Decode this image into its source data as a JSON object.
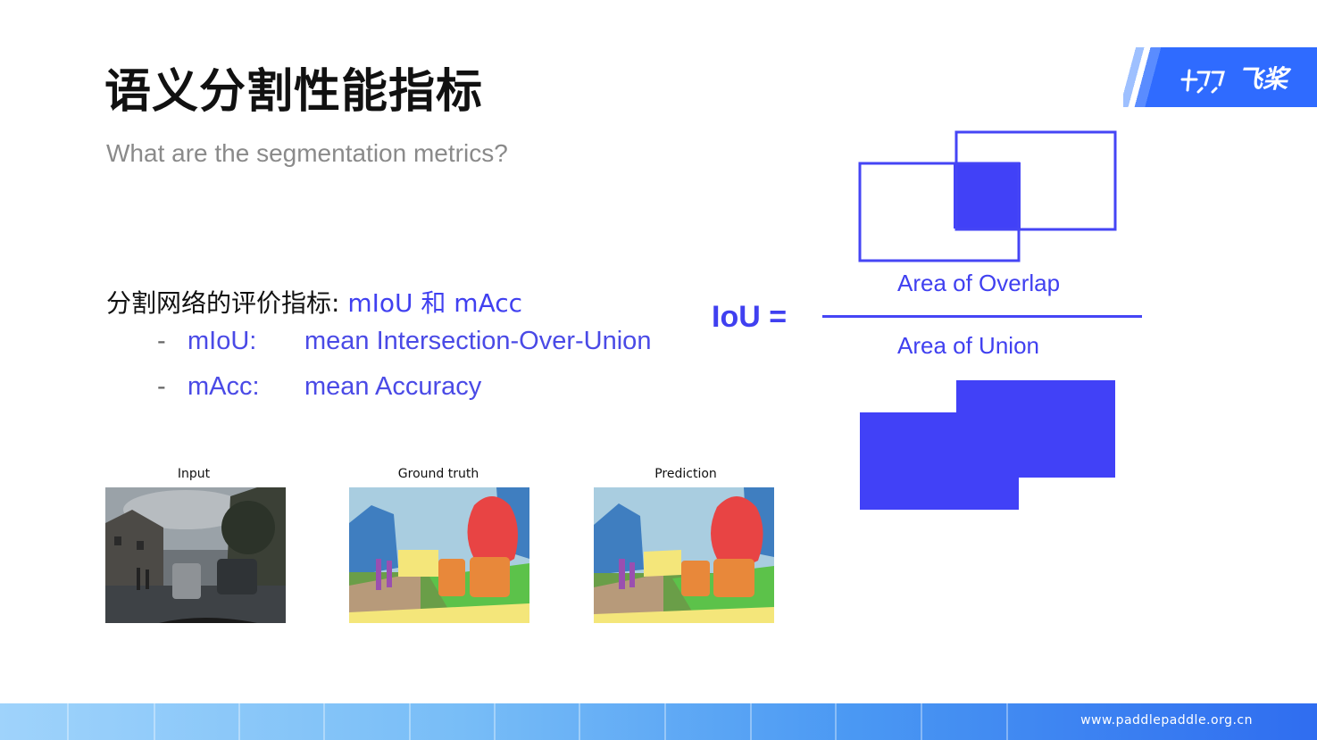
{
  "slide": {
    "title": "语义分割性能指标",
    "subtitle": "What are the segmentation metrics?"
  },
  "logo": {
    "text": "飞桨"
  },
  "metrics": {
    "heading_prefix": "分割网络的评价指标: ",
    "heading_highlight": "mIoU 和 mAcc",
    "items": [
      {
        "dash": "-",
        "abbr": "mIoU:",
        "full": "mean Intersection-Over-Union"
      },
      {
        "dash": "-",
        "abbr": "mAcc:",
        "full": "mean Accuracy"
      }
    ]
  },
  "panels": [
    {
      "label": "Input"
    },
    {
      "label": "Ground truth"
    },
    {
      "label": "Prediction"
    }
  ],
  "iou": {
    "label": "IoU =",
    "numerator": "Area of Overlap",
    "denominator": "Area of Union",
    "accent_color": "#4040f0"
  },
  "footer": {
    "url": "www.paddlepaddle.org.cn"
  }
}
